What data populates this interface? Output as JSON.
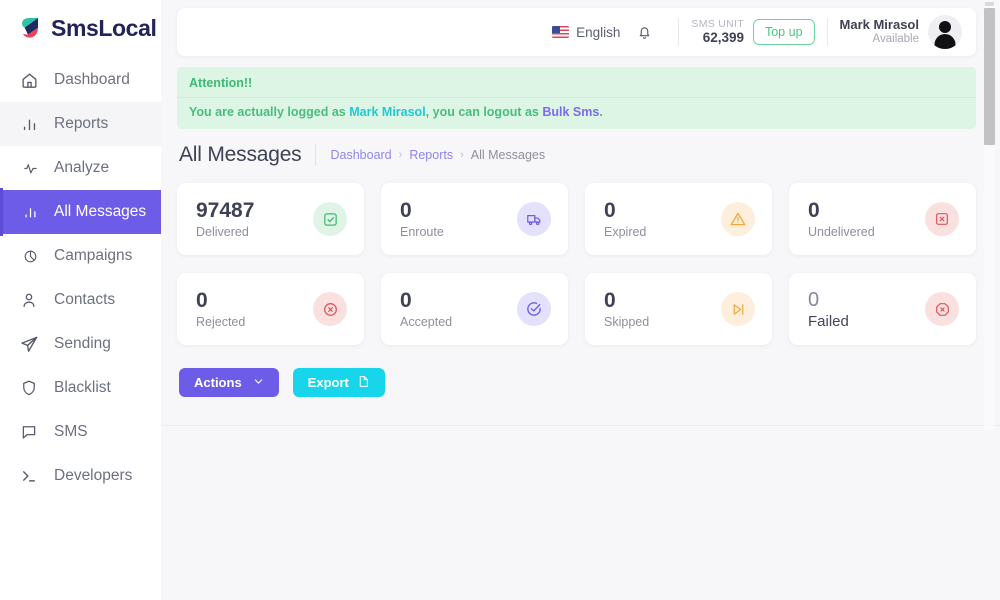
{
  "brand": {
    "name": "SmsLocal"
  },
  "sidebar": {
    "items": [
      {
        "label": "Dashboard",
        "icon": "home-icon",
        "state": "normal"
      },
      {
        "label": "Reports",
        "icon": "bar-chart-icon",
        "state": "shaded"
      },
      {
        "label": "Analyze",
        "icon": "pulse-icon",
        "state": "sub"
      },
      {
        "label": "All Messages",
        "icon": "bar-chart-icon",
        "state": "active"
      },
      {
        "label": "Campaigns",
        "icon": "pie-chart-icon",
        "state": "sub"
      },
      {
        "label": "Contacts",
        "icon": "user-icon",
        "state": "normal"
      },
      {
        "label": "Sending",
        "icon": "send-icon",
        "state": "normal"
      },
      {
        "label": "Blacklist",
        "icon": "shield-icon",
        "state": "normal"
      },
      {
        "label": "SMS",
        "icon": "chat-icon",
        "state": "normal"
      },
      {
        "label": "Developers",
        "icon": "terminal-icon",
        "state": "normal"
      }
    ]
  },
  "topbar": {
    "language": "English",
    "flag_icon": "us-flag-icon",
    "bell_icon": "bell-icon",
    "sms_unit_label": "SMS UNIT",
    "sms_unit_value": "62,399",
    "topup_label": "Top up",
    "user_name": "Mark Mirasol",
    "user_status": "Available",
    "avatar_icon": "avatar-icon"
  },
  "alert": {
    "title": "Attention!!",
    "text_before": "You are actually logged as ",
    "link_user": "Mark Mirasol",
    "text_middle": ", you can logout as ",
    "link_logout": "Bulk Sms",
    "text_after": "."
  },
  "page": {
    "title": "All Messages",
    "breadcrumbs": [
      {
        "label": "Dashboard",
        "current": false
      },
      {
        "label": "Reports",
        "current": false
      },
      {
        "label": "All Messages",
        "current": true
      }
    ],
    "separator": "›"
  },
  "stats": [
    {
      "value": "97487",
      "label": "Delivered",
      "icon": "check-square-icon",
      "tone": "green",
      "style": "bold"
    },
    {
      "value": "0",
      "label": "Enroute",
      "icon": "truck-icon",
      "tone": "purple",
      "style": "bold"
    },
    {
      "value": "0",
      "label": "Expired",
      "icon": "warning-icon",
      "tone": "orange",
      "style": "bold"
    },
    {
      "value": "0",
      "label": "Undelivered",
      "icon": "x-square-icon",
      "tone": "red",
      "style": "bold"
    },
    {
      "value": "0",
      "label": "Rejected",
      "icon": "x-circle-icon",
      "tone": "red",
      "style": "bold"
    },
    {
      "value": "0",
      "label": "Accepted",
      "icon": "check-circle-icon",
      "tone": "purple",
      "style": "bold"
    },
    {
      "value": "0",
      "label": "Skipped",
      "icon": "skip-icon",
      "tone": "orange",
      "style": "bold"
    },
    {
      "value": "0",
      "label": "Failed",
      "icon": "x-octagon-icon",
      "tone": "red",
      "style": "plain"
    }
  ],
  "buttons": {
    "actions_label": "Actions",
    "actions_caret": "chevron-down-icon",
    "export_label": "Export",
    "export_icon": "document-icon"
  },
  "colors": {
    "accent_purple": "#6c5ce7",
    "accent_cyan": "#17d6ec",
    "alert_bg": "#ddf5e4",
    "alert_text": "#49bd7e",
    "page_bg": "#f7f7f9"
  }
}
